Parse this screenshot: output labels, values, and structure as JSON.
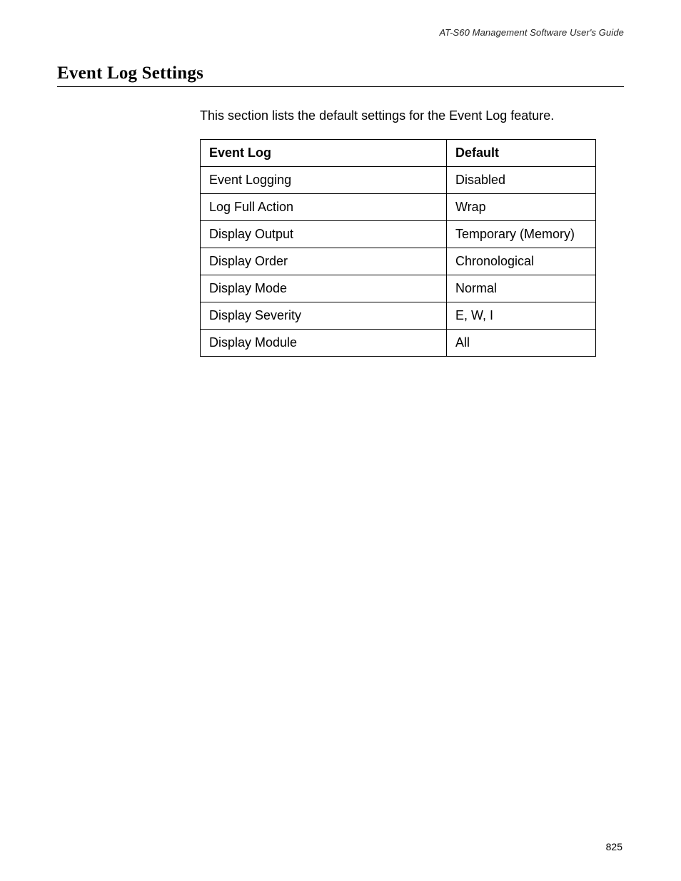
{
  "header": {
    "running_title": "AT-S60 Management Software User's Guide"
  },
  "section": {
    "title": "Event Log Settings",
    "intro": "This section lists the default settings for the Event Log feature."
  },
  "table": {
    "headers": {
      "col1": "Event Log",
      "col2": "Default"
    },
    "rows": [
      {
        "setting": "Event Logging",
        "default": "Disabled"
      },
      {
        "setting": "Log Full Action",
        "default": "Wrap"
      },
      {
        "setting": "Display Output",
        "default": "Temporary (Memory)"
      },
      {
        "setting": "Display Order",
        "default": "Chronological"
      },
      {
        "setting": "Display Mode",
        "default": "Normal"
      },
      {
        "setting": "Display Severity",
        "default": "E, W, I"
      },
      {
        "setting": "Display Module",
        "default": "All"
      }
    ]
  },
  "footer": {
    "page_number": "825"
  }
}
